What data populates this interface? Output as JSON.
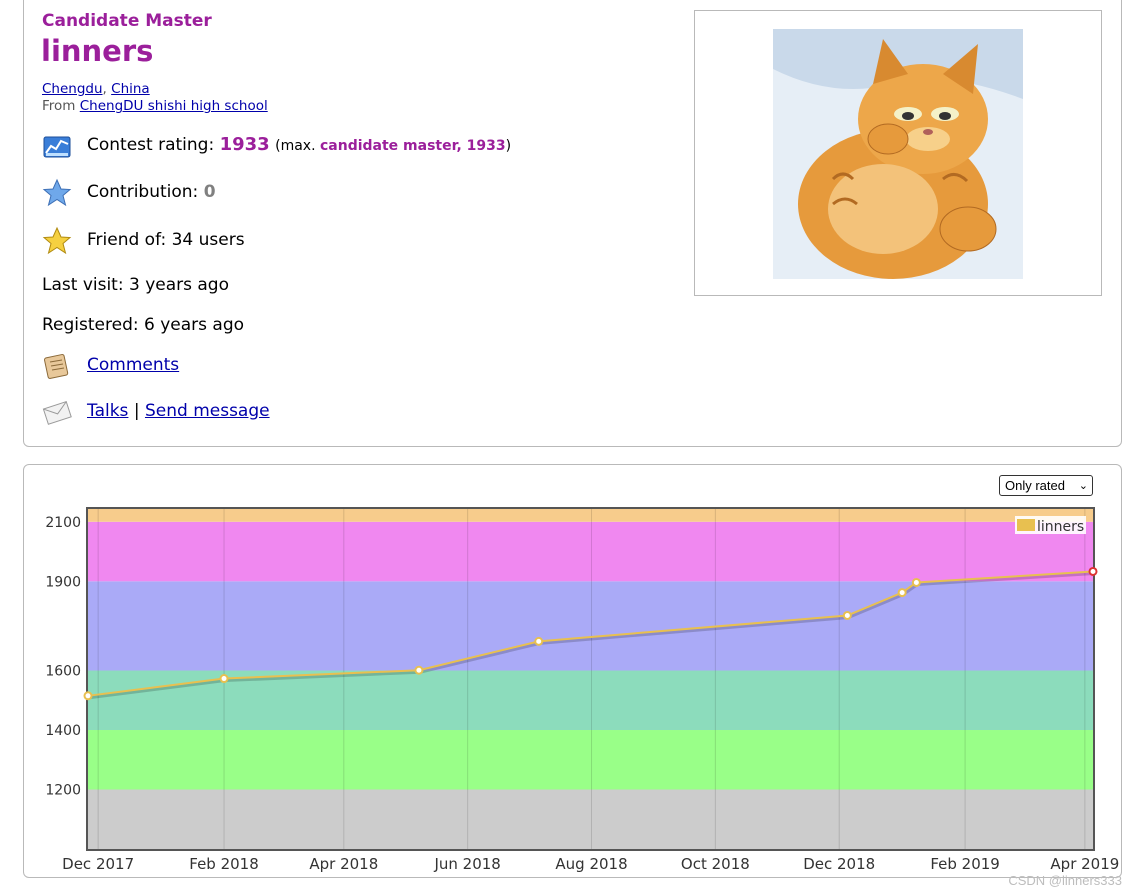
{
  "profile": {
    "rank": "Candidate Master",
    "handle": "linners",
    "city": "Chengdu",
    "country": "China",
    "from_label": "From",
    "school": "ChengDU shishi high school",
    "contest_rating_label": "Contest rating:",
    "contest_rating": "1933",
    "max_prefix": "(max.",
    "max_rank_rating": "candidate master, 1933",
    "max_suffix": ")",
    "contribution_label": "Contribution:",
    "contribution": "0",
    "friend_of": "Friend of: 34 users",
    "last_visit": "Last visit: 3 years ago",
    "registered": "Registered: 6 years ago",
    "comments": "Comments",
    "talks": "Talks",
    "separator": "|",
    "send_message": "Send message",
    "colors": {
      "rank": "#9b1f9b",
      "link": "#0000aa"
    }
  },
  "chart_filter": {
    "selected": "Only rated"
  },
  "watermark": "CSDN @linners333",
  "chart_data": {
    "type": "line",
    "series": [
      {
        "name": "linners",
        "color": "#e8c050",
        "points": [
          [
            "2017-11-26",
            1515
          ],
          [
            "2018-02-01",
            1573
          ],
          [
            "2018-05-08",
            1601
          ],
          [
            "2018-07-06",
            1698
          ],
          [
            "2018-12-05",
            1785
          ],
          [
            "2019-01-01",
            1862
          ],
          [
            "2019-01-08",
            1896
          ],
          [
            "2019-04-05",
            1933
          ]
        ]
      }
    ],
    "xlim": [
      "2017-11-26",
      "2019-04-05"
    ],
    "ylim": [
      1000,
      2143
    ],
    "y_ticks": [
      1200,
      1400,
      1600,
      1900,
      2100
    ],
    "x_ticks": [
      {
        "date": "2017-12-01",
        "label": "Dec 2017"
      },
      {
        "date": "2018-02-01",
        "label": "Feb 2018"
      },
      {
        "date": "2018-04-01",
        "label": "Apr 2018"
      },
      {
        "date": "2018-06-01",
        "label": "Jun 2018"
      },
      {
        "date": "2018-08-01",
        "label": "Aug 2018"
      },
      {
        "date": "2018-10-01",
        "label": "Oct 2018"
      },
      {
        "date": "2018-12-01",
        "label": "Dec 2018"
      },
      {
        "date": "2019-02-01",
        "label": "Feb 2019"
      },
      {
        "date": "2019-04-01",
        "label": "Apr 2019"
      }
    ],
    "bands": [
      {
        "from": 1000,
        "to": 1200,
        "color": "#cccccc"
      },
      {
        "from": 1200,
        "to": 1400,
        "color": "#99ff88"
      },
      {
        "from": 1400,
        "to": 1600,
        "color": "#8cdcbc"
      },
      {
        "from": 1600,
        "to": 1900,
        "color": "#aaaaf7"
      },
      {
        "from": 1900,
        "to": 2100,
        "color": "#f088f0"
      },
      {
        "from": 2100,
        "to": 2143,
        "color": "#f7cc8c"
      }
    ],
    "legend": "top-right",
    "grid": true
  }
}
